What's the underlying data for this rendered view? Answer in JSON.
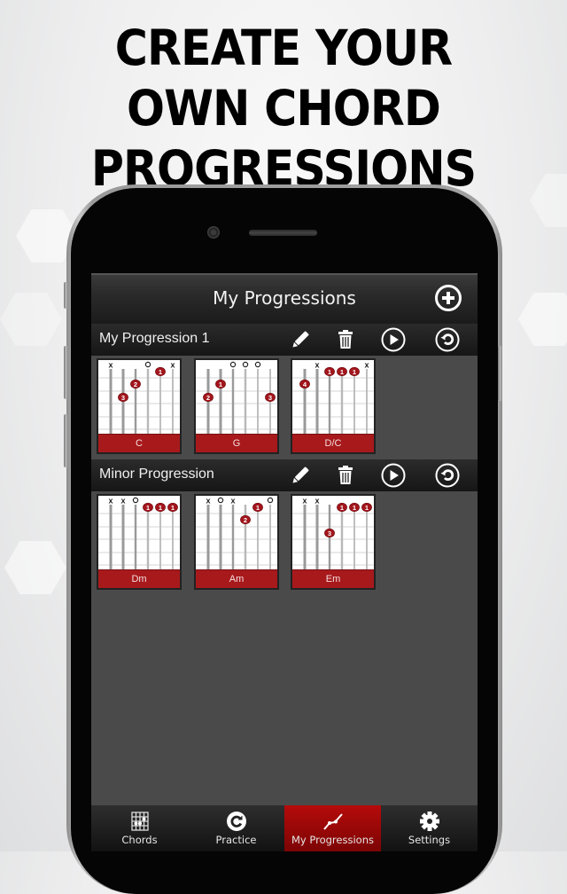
{
  "headline": {
    "lines": [
      "CREATE YOUR",
      "OWN CHORD",
      "PROGRESSIONS"
    ]
  },
  "app": {
    "title": "My Progressions",
    "add_icon": "plus-circle-icon",
    "accent_color": "#a8191c",
    "progression_actions": {
      "edit_icon": "pencil-icon",
      "delete_icon": "trash-icon",
      "play_icon": "play-circle-icon",
      "loop_icon": "loop-circle-icon"
    },
    "progressions": [
      {
        "name": "My Progression 1",
        "chords": [
          {
            "name": "C",
            "markers": [
              "x",
              "",
              "",
              "o",
              "",
              "x"
            ],
            "dots": [
              {
                "string": 2,
                "fret": 3,
                "finger": "3"
              },
              {
                "string": 3,
                "fret": 2,
                "finger": "2"
              },
              {
                "string": 5,
                "fret": 1,
                "finger": "1"
              }
            ]
          },
          {
            "name": "G",
            "markers": [
              "",
              "",
              "o",
              "o",
              "o",
              ""
            ],
            "dots": [
              {
                "string": 1,
                "fret": 3,
                "finger": "2"
              },
              {
                "string": 2,
                "fret": 2,
                "finger": "1"
              },
              {
                "string": 6,
                "fret": 3,
                "finger": "3"
              }
            ]
          },
          {
            "name": "D/C",
            "markers": [
              "",
              "x",
              "",
              "",
              "",
              "x"
            ],
            "dots": [
              {
                "string": 1,
                "fret": 2,
                "finger": "4"
              },
              {
                "string": 3,
                "fret": 1,
                "finger": "1"
              },
              {
                "string": 4,
                "fret": 1,
                "finger": "1"
              },
              {
                "string": 5,
                "fret": 1,
                "finger": "1"
              }
            ]
          }
        ]
      },
      {
        "name": "Minor Progression",
        "chords": [
          {
            "name": "Dm",
            "markers": [
              "x",
              "x",
              "o",
              "",
              "",
              ""
            ],
            "dots": [
              {
                "string": 4,
                "fret": 1,
                "finger": "1"
              },
              {
                "string": 5,
                "fret": 1,
                "finger": "1"
              },
              {
                "string": 6,
                "fret": 1,
                "finger": "1"
              }
            ]
          },
          {
            "name": "Am",
            "markers": [
              "x",
              "o",
              "x",
              "",
              "",
              "o"
            ],
            "dots": [
              {
                "string": 4,
                "fret": 2,
                "finger": "2"
              },
              {
                "string": 5,
                "fret": 1,
                "finger": "1"
              }
            ]
          },
          {
            "name": "Em",
            "markers": [
              "x",
              "x",
              "",
              "",
              "",
              ""
            ],
            "dots": [
              {
                "string": 3,
                "fret": 3,
                "finger": "3"
              },
              {
                "string": 4,
                "fret": 1,
                "finger": "1"
              },
              {
                "string": 5,
                "fret": 1,
                "finger": "1"
              },
              {
                "string": 6,
                "fret": 1,
                "finger": "1"
              }
            ]
          }
        ]
      }
    ],
    "tabs": [
      {
        "label": "Chords",
        "icon": "chord-grid-icon",
        "active": false
      },
      {
        "label": "Practice",
        "icon": "practice-icon",
        "active": false
      },
      {
        "label": "My Progressions",
        "icon": "progression-line-icon",
        "active": true
      },
      {
        "label": "Settings",
        "icon": "gear-icon",
        "active": false
      }
    ]
  }
}
